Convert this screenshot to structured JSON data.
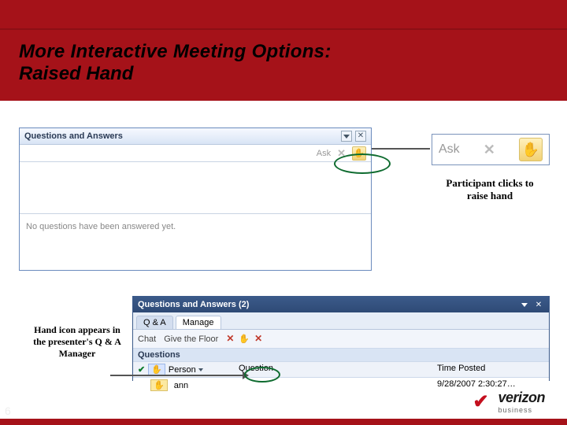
{
  "slide": {
    "title_line1": "More Interactive Meeting Options:",
    "title_line2": "Raised Hand",
    "page_number": "6"
  },
  "qa_panel": {
    "title": "Questions and Answers",
    "ask_label": "Ask",
    "status": "No questions have been answered yet."
  },
  "zoom": {
    "ask_label": "Ask"
  },
  "callouts": {
    "participant": "Participant clicks to raise hand",
    "presenter": "Hand icon appears in the presenter's Q & A Manager"
  },
  "manage_panel": {
    "title": "Questions and Answers (2)",
    "tabs": {
      "qa": "Q & A",
      "manage": "Manage"
    },
    "toolbar": {
      "chat_label": "Chat",
      "give_floor": "Give the Floor"
    },
    "questions_label": "Questions",
    "columns": {
      "person": "Person",
      "question": "Question",
      "time": "Time Posted"
    },
    "row": {
      "person": "ann",
      "question": "",
      "time": "9/28/2007 2:30:27…"
    }
  },
  "logo": {
    "brand": "verizon",
    "unit": "business"
  }
}
